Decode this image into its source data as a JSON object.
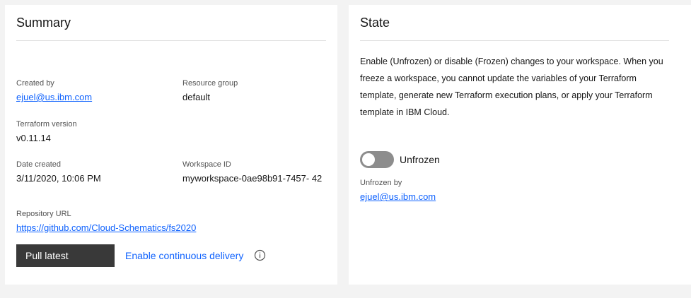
{
  "summary": {
    "title": "Summary",
    "created_by": {
      "label": "Created by",
      "value": "ejuel@us.ibm.com"
    },
    "resource_group": {
      "label": "Resource group",
      "value": "default"
    },
    "terraform_version": {
      "label": "Terraform version",
      "value": "v0.11.14"
    },
    "date_created": {
      "label": "Date created",
      "value": "3/11/2020, 10:06 PM"
    },
    "workspace_id": {
      "label": "Workspace ID",
      "value": "myworkspace-0ae98b91-7457- 42"
    },
    "repository_url": {
      "label": "Repository URL",
      "value": "https://github.com/Cloud-Schematics/fs2020"
    },
    "pull_latest_label": "Pull latest",
    "continuous_delivery_label": "Enable continuous delivery",
    "info_icon": "information-icon"
  },
  "state": {
    "title": "State",
    "description": "Enable (Unfrozen) or disable (Frozen) changes to your workspace. When you freeze a workspace, you cannot update the variables of your Terraform template, generate new Terraform execution plans, or apply your Terraform template in IBM Cloud.",
    "toggle": {
      "label": "Unfrozen",
      "on": false
    },
    "unfrozen_by": {
      "label": "Unfrozen by",
      "value": "ejuel@us.ibm.com"
    }
  },
  "colors": {
    "background": "#f3f3f3",
    "card": "#ffffff",
    "link": "#0f62fe",
    "button": "#393939",
    "toggle_off": "#8d8d8d"
  }
}
